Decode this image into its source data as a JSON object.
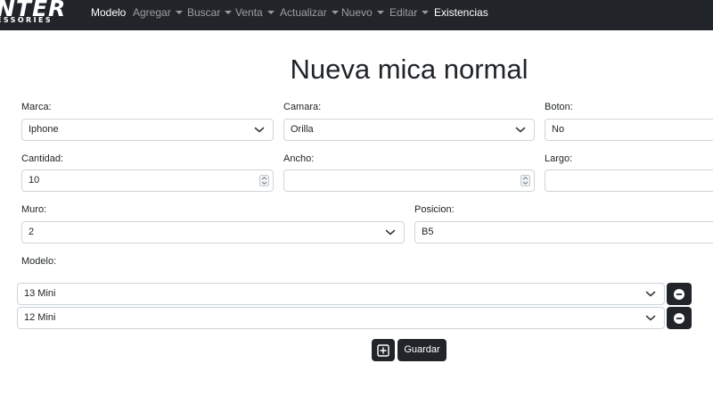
{
  "navbar": {
    "brand_main": "NTER",
    "brand_sub": "ESSORIES",
    "items": [
      {
        "label": "Modelo"
      },
      {
        "label": "Agregar"
      },
      {
        "label": "Buscar"
      },
      {
        "label": "Venta"
      },
      {
        "label": "Actualizar"
      },
      {
        "label": "Nuevo"
      },
      {
        "label": "Editar"
      },
      {
        "label": "Existencias"
      }
    ]
  },
  "page": {
    "title": "Nueva mica normal"
  },
  "form": {
    "marca": {
      "label": "Marca:",
      "value": "Iphone"
    },
    "camara": {
      "label": "Camara:",
      "value": "Orilla"
    },
    "boton": {
      "label": "Boton:",
      "value": "No"
    },
    "cantidad": {
      "label": "Cantidad:",
      "value": "10"
    },
    "ancho": {
      "label": "Ancho:",
      "value": ""
    },
    "largo": {
      "label": "Largo:",
      "value": ""
    },
    "muro": {
      "label": "Muro:",
      "value": "2"
    },
    "posicion": {
      "label": "Posicion:",
      "value": "B5"
    },
    "modelo": {
      "label": "Modelo:",
      "rows": [
        {
          "value": "13 Mini"
        },
        {
          "value": "12 Mini"
        }
      ]
    }
  },
  "actions": {
    "save_label": "Guardar"
  },
  "colors": {
    "navbar_bg": "#212529",
    "button_bg": "#212529",
    "input_border": "#ced4da"
  }
}
